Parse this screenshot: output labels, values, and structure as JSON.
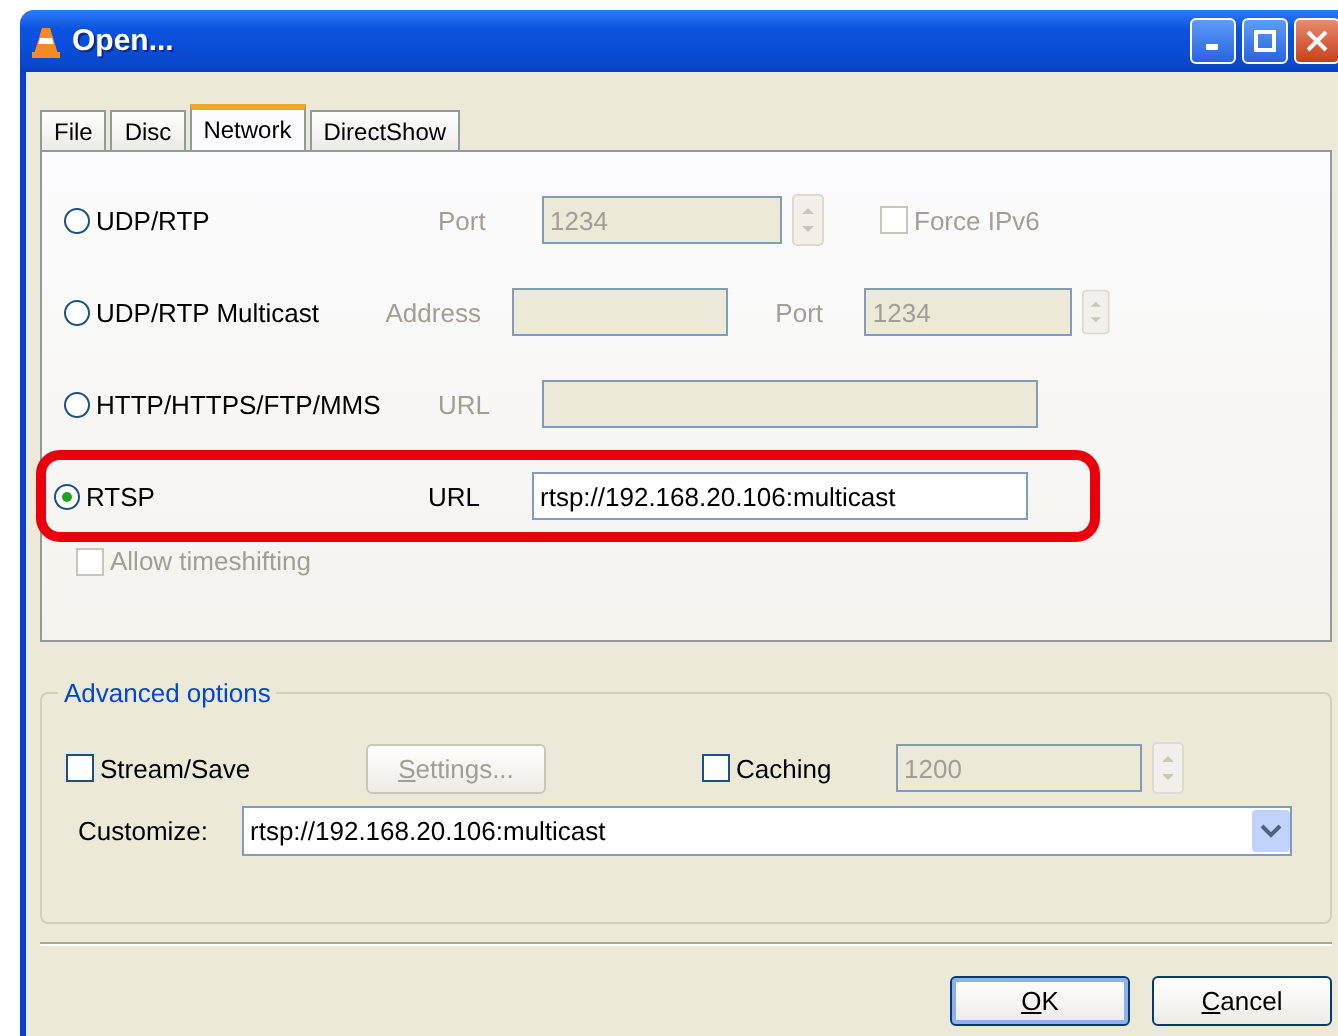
{
  "window": {
    "title": "Open..."
  },
  "tabs": [
    {
      "label": "File",
      "selected": false
    },
    {
      "label": "Disc",
      "selected": false
    },
    {
      "label": "Network",
      "selected": true
    },
    {
      "label": "DirectShow",
      "selected": false
    }
  ],
  "protocols": [
    {
      "label": "UDP/RTP",
      "selected": false,
      "highlighted": false,
      "fields": [
        {
          "kind": "spin",
          "label": "Port",
          "value": "1234",
          "disabled": true
        }
      ],
      "checkbox": {
        "label": "Force IPv6",
        "checked": false,
        "disabled": true
      }
    },
    {
      "label": "UDP/RTP Multicast",
      "selected": false,
      "highlighted": false,
      "fields": [
        {
          "kind": "short",
          "label": "Address",
          "disabled": true
        },
        {
          "kind": "spin",
          "label": "Port",
          "value": "1234",
          "disabled": true
        }
      ]
    },
    {
      "label": "HTTP/HTTPS/FTP/MMS",
      "selected": false,
      "highlighted": false,
      "fields": [
        {
          "kind": "long",
          "label": "URL",
          "disabled": true
        }
      ]
    },
    {
      "label": "RTSP",
      "selected": true,
      "highlighted": true,
      "fields": [
        {
          "kind": "long",
          "label": "URL",
          "value": "rtsp://192.168.20.106:multicast",
          "disabled": false
        }
      ]
    }
  ],
  "allow_timeshifting": {
    "label": "Allow timeshifting",
    "checked": false,
    "disabled": true
  },
  "advanced": {
    "title": "Advanced options",
    "stream_save": {
      "label": "Stream/Save",
      "checked": false
    },
    "settings_button": {
      "label": "Settings...",
      "disabled": true
    },
    "caching": {
      "label": "Caching",
      "checked": false
    },
    "caching_value": {
      "value": "1200",
      "disabled": true
    },
    "customize": {
      "label": "Customize:",
      "value": "rtsp://192.168.20.106:multicast"
    }
  },
  "buttons": [
    {
      "label": "OK",
      "default": true
    },
    {
      "label": "Cancel",
      "default": false
    }
  ]
}
